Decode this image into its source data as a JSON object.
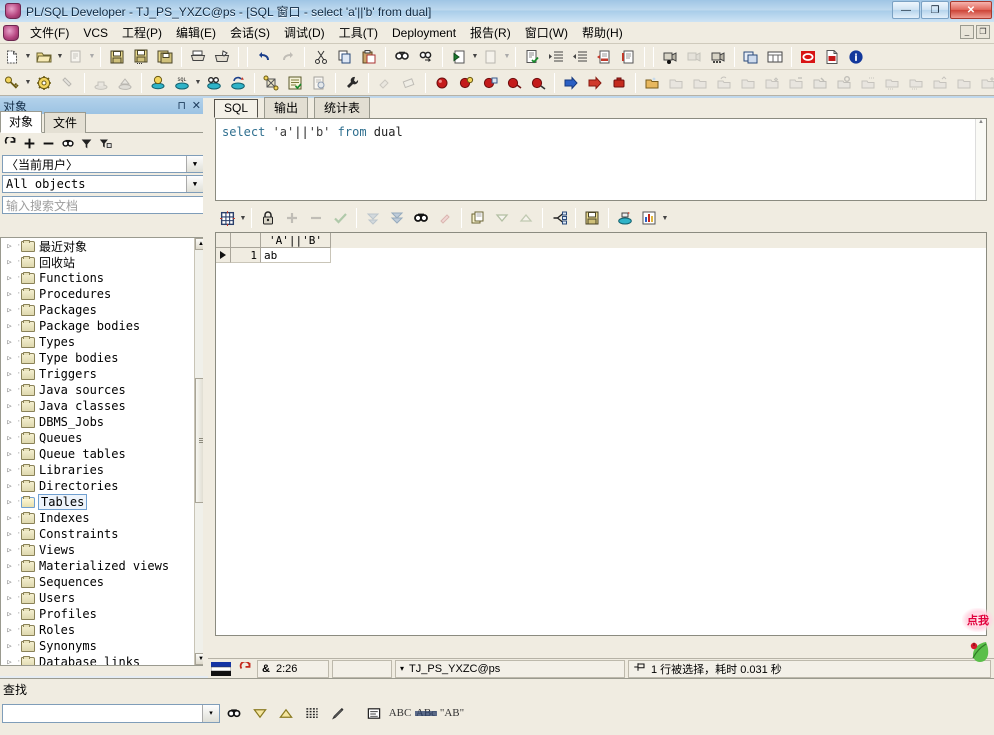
{
  "window": {
    "title": "PL/SQL Developer - TJ_PS_YXZC@ps - [SQL 窗口 - select 'a'||'b' from dual]",
    "minimize_label": "—",
    "maximize_label": "❐",
    "close_label": "✕",
    "inner_minimize_label": "_",
    "inner_restore_label": "❐",
    "inner_close_label": "✕"
  },
  "menubar": {
    "items": [
      {
        "label": "文件(F)"
      },
      {
        "label": "VCS"
      },
      {
        "label": "工程(P)"
      },
      {
        "label": "编辑(E)"
      },
      {
        "label": "会话(S)"
      },
      {
        "label": "调试(D)"
      },
      {
        "label": "工具(T)"
      },
      {
        "label": "Deployment"
      },
      {
        "label": "报告(R)"
      },
      {
        "label": "窗口(W)"
      },
      {
        "label": "帮助(H)"
      }
    ],
    "app_icon": "oracle-barrel-icon"
  },
  "toolbar_row1": {
    "icons": [
      "new-document-icon",
      "open-folder-icon",
      "print-preview-icon",
      "save-icon",
      "save-all-icon",
      "save-as-icon",
      "print-icon",
      "print-setup-icon",
      "undo-icon",
      "redo-icon",
      "cut-icon",
      "copy-icon",
      "paste-icon",
      "find-icon",
      "find-next-icon",
      "go-back-icon",
      "go-forward-icon",
      "check-syntax-icon",
      "indent-icon",
      "outdent-icon",
      "comment-icon",
      "uncomment-icon",
      "record-macro-icon",
      "pause-macro-icon",
      "play-macro-icon",
      "window-tile-icon",
      "window-list-icon",
      "oracle-icon",
      "pdf-icon",
      "about-icon"
    ]
  },
  "toolbar_row2": {
    "icons": [
      "key-icon",
      "gear-icon",
      "pin-icon",
      "import-icon",
      "export-icon",
      "new-session-icon",
      "sql-window-icon",
      "test-window-icon",
      "rollback-session-icon",
      "explain-plan-icon",
      "session-list-icon",
      "report-icon",
      "wrench-icon",
      "cleanup-icon",
      "erase-icon",
      "breakpoint-icon",
      "breakpoint-add-icon",
      "breakpoint-toggle-icon",
      "breakpoint-list-icon",
      "breakpoint-clear-icon",
      "step-into-icon",
      "step-over-icon",
      "stop-icon",
      "folder-new-icon",
      "folder-step-icon",
      "folder-back-icon",
      "folder-refresh-icon",
      "folder-next-icon",
      "folder-diff-icon",
      "folder-minus-icon",
      "folder-link-icon",
      "folder-search-icon",
      "folder-dots-icon",
      "folder-down-icon",
      "folder-down2-icon",
      "folder-up-icon",
      "folder-sync-icon",
      "folder-plus-icon",
      "folder-go-icon",
      "folder-tool-icon"
    ]
  },
  "sidebar": {
    "title": "对象",
    "pin_label": "⊓",
    "close_label": "✕",
    "tabs": [
      {
        "label": "对象",
        "active": true
      },
      {
        "label": "文件",
        "active": false
      }
    ],
    "toolbar_icons": [
      "refresh-icon",
      "add-icon",
      "remove-icon",
      "find-icon",
      "filter-icon",
      "filter-lock-icon"
    ],
    "user_combo": "〈当前用户〉",
    "filter_combo": "All objects",
    "search_placeholder": "输入搜索文档",
    "tree_items": [
      {
        "label": "最近对象",
        "selected": false
      },
      {
        "label": "回收站",
        "selected": false
      },
      {
        "label": "Functions",
        "selected": false
      },
      {
        "label": "Procedures",
        "selected": false
      },
      {
        "label": "Packages",
        "selected": false
      },
      {
        "label": "Package bodies",
        "selected": false
      },
      {
        "label": "Types",
        "selected": false
      },
      {
        "label": "Type bodies",
        "selected": false
      },
      {
        "label": "Triggers",
        "selected": false
      },
      {
        "label": "Java sources",
        "selected": false
      },
      {
        "label": "Java classes",
        "selected": false
      },
      {
        "label": "DBMS_Jobs",
        "selected": false
      },
      {
        "label": "Queues",
        "selected": false
      },
      {
        "label": "Queue tables",
        "selected": false
      },
      {
        "label": "Libraries",
        "selected": false
      },
      {
        "label": "Directories",
        "selected": false
      },
      {
        "label": "Tables",
        "selected": true
      },
      {
        "label": "Indexes",
        "selected": false
      },
      {
        "label": "Constraints",
        "selected": false
      },
      {
        "label": "Views",
        "selected": false
      },
      {
        "label": "Materialized views",
        "selected": false
      },
      {
        "label": "Sequences",
        "selected": false
      },
      {
        "label": "Users",
        "selected": false
      },
      {
        "label": "Profiles",
        "selected": false
      },
      {
        "label": "Roles",
        "selected": false
      },
      {
        "label": "Synonyms",
        "selected": false
      },
      {
        "label": "Database links",
        "selected": false
      }
    ]
  },
  "editor": {
    "tabs": [
      {
        "label": "SQL",
        "active": true
      },
      {
        "label": "输出",
        "active": false
      },
      {
        "label": "统计表",
        "active": false
      }
    ],
    "sql_tokens": [
      {
        "text": "select ",
        "kind": "kw"
      },
      {
        "text": "'a'",
        "kind": "str"
      },
      {
        "text": "||",
        "kind": "pln"
      },
      {
        "text": "'b'",
        "kind": "str"
      },
      {
        "text": " ",
        "kind": "pln"
      },
      {
        "text": "from ",
        "kind": "kw"
      },
      {
        "text": "dual",
        "kind": "pln"
      }
    ],
    "sql_text": "select 'a'||'b' from dual"
  },
  "grid_toolbar": {
    "icons": [
      "grid-layout-icon",
      "lock-icon",
      "add-row-icon",
      "delete-row-icon",
      "commit-check-icon",
      "next-page-icon",
      "last-page-icon",
      "find-icon",
      "highlight-icon",
      "copy-data-icon",
      "sort-desc-icon",
      "sort-asc-icon",
      "chart-link-icon",
      "save-data-icon",
      "export-db-icon",
      "chart-icon"
    ]
  },
  "result_grid": {
    "columns": [
      "'A'||'B'"
    ],
    "rows": [
      {
        "num": "1",
        "values": [
          "ab"
        ]
      }
    ]
  },
  "statusbar": {
    "connection_icon": "db-icon",
    "refresh_icon": "refresh-red-icon",
    "lock_icon": "ampersand-icon",
    "position": "2:26",
    "session_dropdown_caret": "▾",
    "session": "TJ_PS_YXZC@ps",
    "result_icon": "pin-red-icon",
    "result_text": "1 行被选择，耗时 0.031 秒"
  },
  "findbar": {
    "title": "查找",
    "input_value": "",
    "dropdown_caret": "▾",
    "buttons": [
      {
        "name": "find-binoculars-icon",
        "label": ""
      },
      {
        "name": "find-down-icon",
        "label": ""
      },
      {
        "name": "find-up-icon",
        "label": ""
      },
      {
        "name": "find-all-icon",
        "label": ""
      },
      {
        "name": "highlight-pen-icon",
        "label": ""
      },
      {
        "name": "find-in-selection-icon",
        "label": ""
      },
      {
        "name": "match-case-icon",
        "label": "ABC"
      },
      {
        "name": "whole-word-icon",
        "label": "ABc"
      },
      {
        "name": "regex-icon",
        "label": "\"AB\""
      }
    ]
  },
  "float_widget": {
    "text": "点我"
  },
  "colors": {
    "titlebar_accent": "#9fc5e4",
    "panel_bg": "#f0ece1",
    "selection_blue": "#6f9fd0",
    "keyword": "#2f6f8f",
    "accent_red": "#e1003c"
  }
}
